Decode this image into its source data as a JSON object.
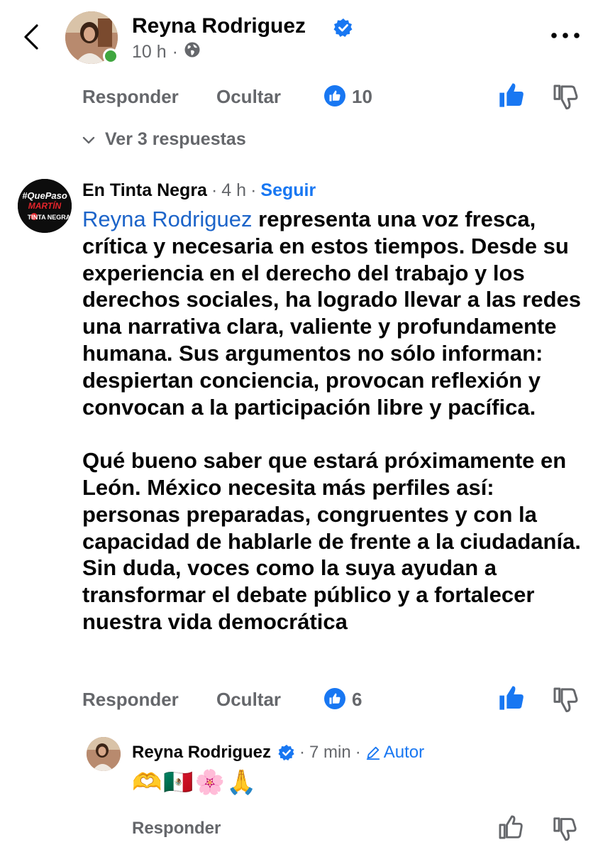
{
  "header": {
    "name": "Reyna Rodriguez",
    "time": "10 h",
    "separator": "·",
    "back_icon": "chevron-left-icon",
    "privacy_icon": "globe-icon",
    "more_icon": "more-horizontal-icon"
  },
  "prev_comment_actions": {
    "reply_label": "Responder",
    "hide_label": "Ocultar",
    "like_count": "10"
  },
  "replies_toggle": {
    "label": "Ver 3 respuestas"
  },
  "comment": {
    "author": "En Tinta Negra",
    "sep1": "·",
    "time": "4 h",
    "sep2": "·",
    "follow_label": "Seguir",
    "avatar_text": {
      "hashtag": "#QuePaso",
      "name": "MARTÍN",
      "brand": "TINTA NEGRA"
    },
    "mention": "Reyna Rodriguez",
    "paragraph1_rest": " representa una voz fresca, crítica y necesaria en estos tiempos. Desde su experiencia en el derecho del trabajo y los derechos sociales, ha logrado llevar a las redes una narrativa clara, valiente y profundamente humana. Sus argumentos no sólo informan: despiertan conciencia, provocan reflexión y convocan a la participación libre y pacífica.",
    "paragraph2": "Qué bueno saber que estará próximamente en León. México necesita más perfiles así: personas preparadas, congruentes y con la capacidad de hablarle de frente a la ciudadanía. Sin duda, voces como la suya ayudan a transformar el debate público y a fortalecer nuestra vida democrática",
    "reply_label": "Responder",
    "hide_label": "Ocultar",
    "like_count": "6"
  },
  "reply": {
    "author": "Reyna Rodriguez",
    "sep1": "·",
    "time": "7 min",
    "sep2": "·",
    "author_badge": "Autor",
    "emojis": "🫶🇲🇽🌸🙏",
    "reply_label": "Responder"
  },
  "colors": {
    "accent": "#1877f2",
    "secondary_text": "#65676b",
    "online": "#3fa63f"
  }
}
